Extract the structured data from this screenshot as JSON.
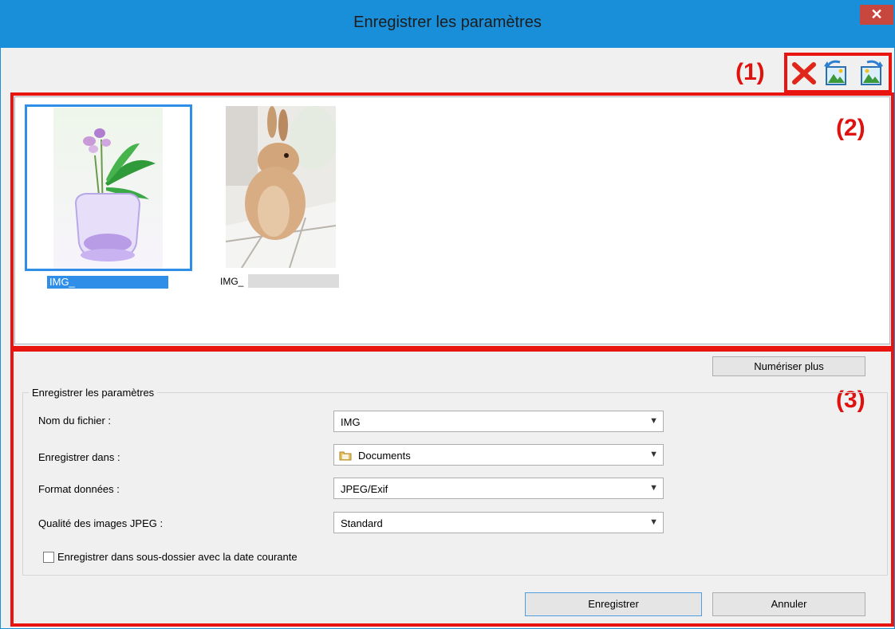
{
  "window": {
    "title": "Enregistrer les paramètres",
    "close_glyph": "✕"
  },
  "callouts": {
    "one": "(1)",
    "two": "(2)",
    "three": "(3)"
  },
  "toolbar": {
    "icons": [
      "delete-icon",
      "rotate-left-icon",
      "rotate-right-icon"
    ],
    "delete_glyph": "✕"
  },
  "thumbnails": [
    {
      "label": "IMG_",
      "selected": true,
      "subject": "flower-vase"
    },
    {
      "label": "IMG_",
      "selected": false,
      "subject": "rabbit"
    }
  ],
  "buttons": {
    "scan_more": "Numériser plus",
    "save": "Enregistrer",
    "cancel": "Annuler"
  },
  "settings": {
    "group_title": "Enregistrer les paramètres",
    "filename_label": "Nom du fichier :",
    "filename_value": "IMG",
    "save_in_label": "Enregistrer dans :",
    "save_in_value": "Documents",
    "format_label": "Format données :",
    "format_value": "JPEG/Exif",
    "jpeg_quality_label": "Qualité des images JPEG :",
    "jpeg_quality_value": "Standard",
    "subfolder_checkbox_label": "Enregistrer dans sous-dossier avec la date courante",
    "subfolder_checked": false
  },
  "colors": {
    "title_bar": "#1a8fd9",
    "close": "#c7463e",
    "callout": "#e0120f",
    "selection": "#2f8fe8"
  }
}
